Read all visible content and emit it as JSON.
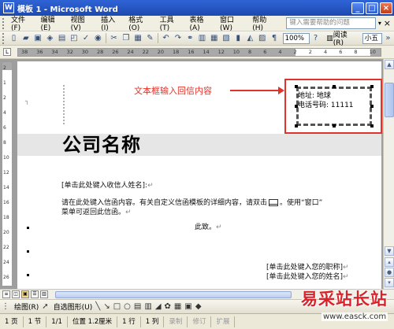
{
  "window": {
    "title": "模板 1 - Microsoft Word",
    "minimize": "_",
    "maximize": "□",
    "close": "×"
  },
  "menu": {
    "items": [
      "文件(F)",
      "编辑(E)",
      "视图(V)",
      "插入(I)",
      "格式(O)",
      "工具(T)",
      "表格(A)",
      "窗口(W)",
      "帮助(H)"
    ],
    "help_placeholder": "键入需要帮助的问题",
    "close": "×"
  },
  "toolbar": {
    "zoom": "100%",
    "read_label": "阅读(R)",
    "font_size": "小五"
  },
  "ruler": {
    "h_ticks": [
      "38",
      "36",
      "34",
      "32",
      "30",
      "28",
      "26",
      "24",
      "22",
      "20",
      "18",
      "16",
      "14",
      "12",
      "10",
      "8",
      "6",
      "4",
      "2",
      "2",
      "4",
      "6",
      "8",
      "10"
    ],
    "v_ticks": [
      "2",
      "1",
      "2",
      "4",
      "6",
      "8",
      "10",
      "12",
      "14",
      "16",
      "18",
      "20",
      "22",
      "24",
      "26"
    ]
  },
  "document": {
    "company_name": "公司名称",
    "recipient_placeholder": "[单击此处键入收信人姓名]:",
    "body_line1": "请在此处键入信函内容。有关自定义信函模板的详细内容，请双击",
    "body_line1_tail": "。使用“窗口”",
    "body_line2": "菜单可返回此信函。",
    "closing": "此致。",
    "title_placeholder": "[单击此处键入您的职称]",
    "name_placeholder": "[单击此处键入您的姓名]",
    "para_mark": "↵"
  },
  "textbox": {
    "address": "地址: 地球",
    "phone": "电话号码: 11111"
  },
  "annotation": {
    "label": "文本框输入回信内容",
    "color": "#e0332a"
  },
  "drawbar": {
    "draw_label": "绘图(R)",
    "autoshapes_label": "自选图形(U)"
  },
  "status": {
    "page": "1 页",
    "section": "1 节",
    "page_of": "1/1",
    "position": "位置 1.2厘米",
    "line": "1 行",
    "column": "1 列",
    "rec": "录制",
    "trk": "修订",
    "ext": "扩展"
  },
  "watermark": {
    "text": "易采站长站",
    "url": "www.easck.com"
  }
}
